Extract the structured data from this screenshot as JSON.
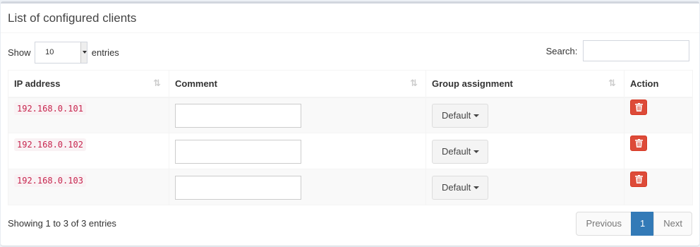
{
  "box": {
    "title": "List of configured clients"
  },
  "length_menu": {
    "show_label": "Show",
    "value": "10",
    "entries_label": "entries"
  },
  "search": {
    "label": "Search:",
    "value": ""
  },
  "table": {
    "headers": [
      "IP address",
      "Comment",
      "Group assignment",
      "Action"
    ],
    "rows": [
      {
        "ip": "192.168.0.101",
        "comment": "",
        "group": "Default"
      },
      {
        "ip": "192.168.0.102",
        "comment": "",
        "group": "Default"
      },
      {
        "ip": "192.168.0.103",
        "comment": "",
        "group": "Default"
      }
    ]
  },
  "info": "Showing 1 to 3 of 3 entries",
  "pagination": {
    "previous": "Previous",
    "current": "1",
    "next": "Next"
  },
  "icons": {
    "sort": "sort-icon",
    "delete": "trash-icon",
    "dropdown": "caret-down-icon"
  },
  "colors": {
    "danger": "#dd4b39",
    "primary": "#337ab7",
    "code": "#c7254e"
  }
}
